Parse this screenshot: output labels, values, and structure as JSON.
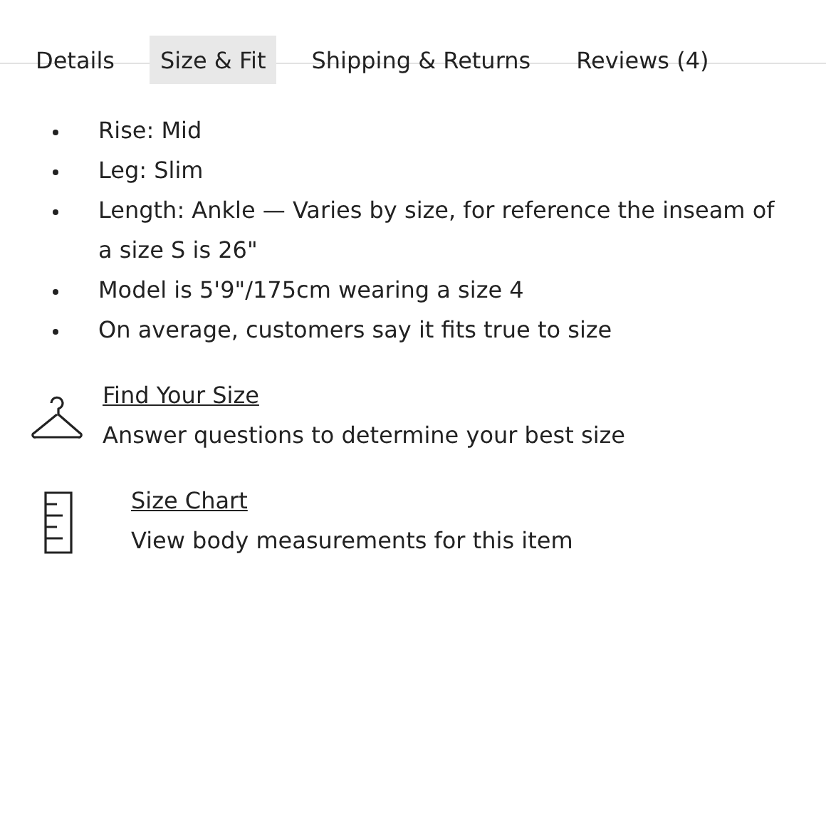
{
  "tabs": [
    {
      "label": "Details",
      "selected": false
    },
    {
      "label": "Size & Fit",
      "selected": true
    },
    {
      "label": "Shipping & Returns",
      "selected": false
    },
    {
      "label": "Reviews (4)",
      "selected": false
    }
  ],
  "details": [
    "Rise: Mid",
    "Leg: Slim",
    "Length: Ankle — Varies by size, for reference the inseam of a size S is 26\"",
    "Model is 5'9\"/175cm wearing a size 4",
    "On average, customers say it fits true to size"
  ],
  "tools": [
    {
      "kind": "hanger",
      "link": "Find Your Size",
      "description": "Answer questions to determine your best size"
    },
    {
      "kind": "ruler",
      "link": "Size Chart",
      "description": "View body measurements for this item"
    }
  ]
}
